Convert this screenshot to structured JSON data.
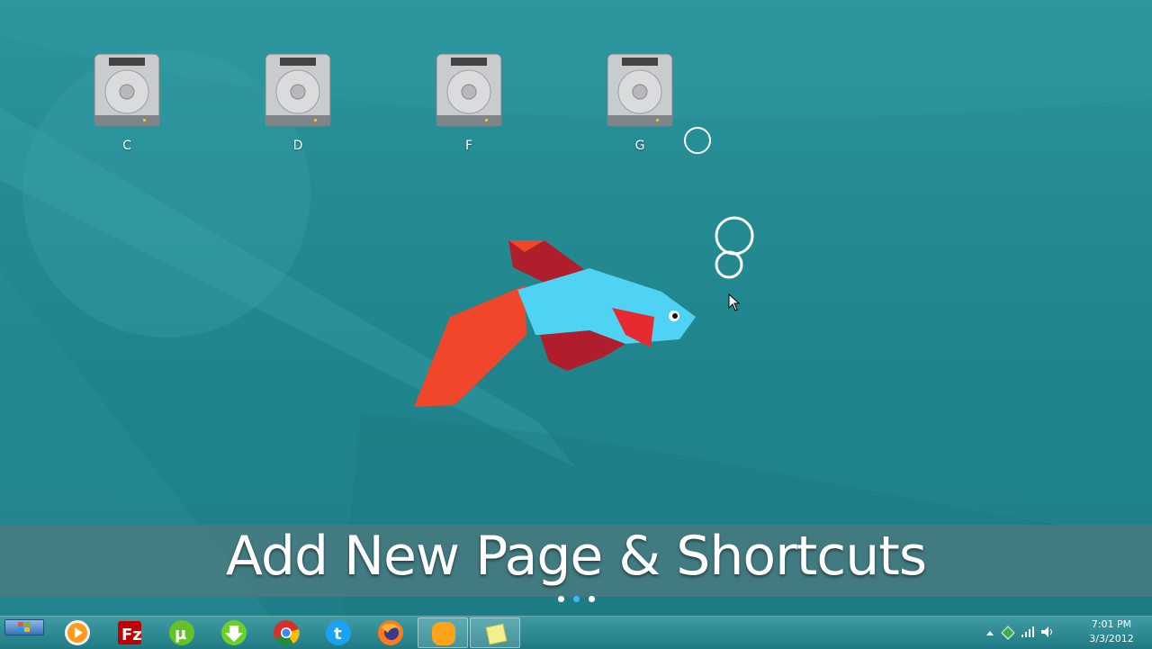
{
  "desktop": {
    "drives": [
      {
        "label": "C"
      },
      {
        "label": "D"
      },
      {
        "label": "F"
      },
      {
        "label": "G"
      }
    ]
  },
  "banner": {
    "title": "Add New Page & Shortcuts"
  },
  "page_indicator": {
    "dots": 3,
    "active_index": 1
  },
  "taskbar": {
    "apps": [
      {
        "name": "media-player-icon"
      },
      {
        "name": "filezilla-icon"
      },
      {
        "name": "utorrent-icon"
      },
      {
        "name": "download-manager-icon"
      },
      {
        "name": "chrome-icon"
      },
      {
        "name": "twitter-icon"
      },
      {
        "name": "firefox-icon"
      },
      {
        "name": "orange-app-icon",
        "active": true
      },
      {
        "name": "sticky-notes-icon",
        "active": true
      }
    ],
    "tray": {
      "time": "7:01 PM",
      "date": "3/3/2012"
    }
  },
  "colors": {
    "background": "#24868f",
    "fish_body": "#4fd3f5",
    "fish_fin_dark": "#b01e2e",
    "fish_fin_orange": "#f0462a"
  }
}
